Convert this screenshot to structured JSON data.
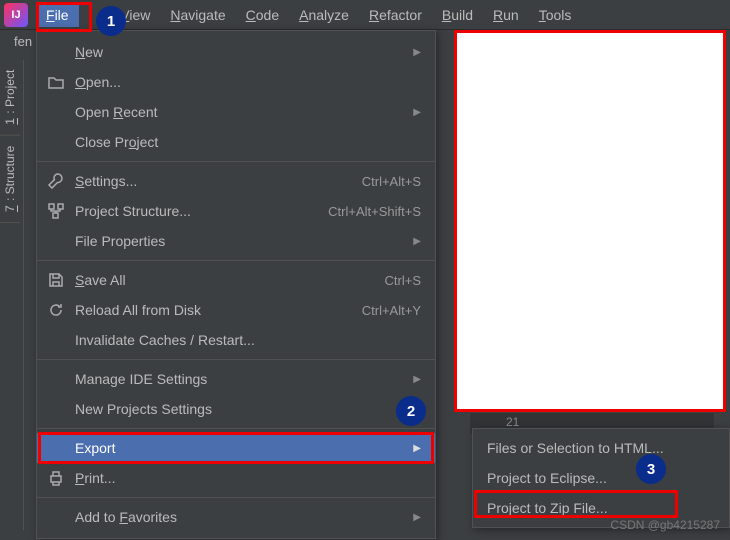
{
  "menubar": {
    "items": [
      "File",
      "",
      "View",
      "Navigate",
      "Code",
      "Analyze",
      "Refactor",
      "Build",
      "Run",
      "Tools"
    ],
    "active_index": 0
  },
  "breadcrumb": "fen",
  "sidebar": {
    "tabs": [
      {
        "num": "1",
        "label": "Project"
      },
      {
        "num": "7",
        "label": "Structure"
      }
    ]
  },
  "file_menu": {
    "groups": [
      [
        {
          "icon": "",
          "label": "New",
          "u": 0,
          "shortcut": "",
          "arrow": true
        },
        {
          "icon": "folder",
          "label": "Open...",
          "u": 0,
          "shortcut": "",
          "arrow": false
        },
        {
          "icon": "",
          "label": "Open Recent",
          "u": 5,
          "shortcut": "",
          "arrow": true
        },
        {
          "icon": "",
          "label": "Close Project",
          "u": 8,
          "shortcut": "",
          "arrow": false
        }
      ],
      [
        {
          "icon": "wrench",
          "label": "Settings...",
          "u": 0,
          "shortcut": "Ctrl+Alt+S",
          "arrow": false
        },
        {
          "icon": "structure",
          "label": "Project Structure...",
          "u": -1,
          "shortcut": "Ctrl+Alt+Shift+S",
          "arrow": false
        },
        {
          "icon": "",
          "label": "File Properties",
          "u": -1,
          "shortcut": "",
          "arrow": true
        }
      ],
      [
        {
          "icon": "saveall",
          "label": "Save All",
          "u": 0,
          "shortcut": "Ctrl+S",
          "arrow": false
        },
        {
          "icon": "reload",
          "label": "Reload All from Disk",
          "u": -1,
          "shortcut": "Ctrl+Alt+Y",
          "arrow": false
        },
        {
          "icon": "",
          "label": "Invalidate Caches / Restart...",
          "u": -1,
          "shortcut": "",
          "arrow": false
        }
      ],
      [
        {
          "icon": "",
          "label": "Manage IDE Settings",
          "u": -1,
          "shortcut": "",
          "arrow": true
        },
        {
          "icon": "",
          "label": "New Projects Settings",
          "u": -1,
          "shortcut": "",
          "arrow": true
        }
      ],
      [
        {
          "icon": "",
          "label": "Export",
          "u": -1,
          "shortcut": "",
          "arrow": true,
          "highlight": true
        },
        {
          "icon": "print",
          "label": "Print...",
          "u": 0,
          "shortcut": "",
          "arrow": false
        }
      ],
      [
        {
          "icon": "",
          "label": "Add to Favorites",
          "u": 7,
          "shortcut": "",
          "arrow": true
        }
      ]
    ]
  },
  "export_submenu": {
    "items": [
      "Files or Selection to HTML...",
      "Project to Eclipse...",
      "Project to Zip File..."
    ]
  },
  "gutter_line": "21",
  "annotations": {
    "a1": "1",
    "a2": "2",
    "a3": "3"
  },
  "watermark": "CSDN @gb4215287"
}
